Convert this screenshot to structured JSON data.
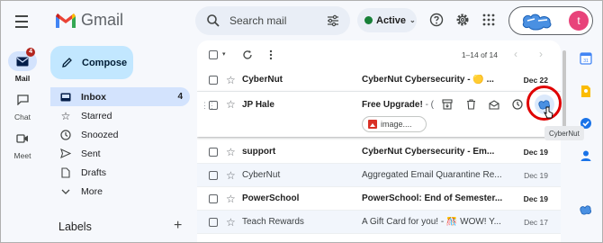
{
  "app": {
    "name": "Gmail"
  },
  "rail": {
    "mail": {
      "label": "Mail",
      "badge": "4"
    },
    "chat": {
      "label": "Chat"
    },
    "meet": {
      "label": "Meet"
    }
  },
  "search": {
    "placeholder": "Search mail"
  },
  "status": {
    "label": "Active",
    "color": "#188038"
  },
  "account": {
    "avatar_letter": "t",
    "avatar_color": "#e8437a"
  },
  "compose": {
    "label": "Compose"
  },
  "nav": [
    {
      "label": "Inbox",
      "count": "4",
      "icon": "inbox-icon",
      "active": true
    },
    {
      "label": "Starred",
      "icon": "star-icon"
    },
    {
      "label": "Snoozed",
      "icon": "clock-icon"
    },
    {
      "label": "Sent",
      "icon": "send-icon"
    },
    {
      "label": "Drafts",
      "icon": "draft-icon"
    },
    {
      "label": "More",
      "icon": "chevron-down-icon"
    }
  ],
  "labels": {
    "heading": "Labels",
    "add": "+"
  },
  "toolbar": {
    "pager": "1–14 of 14"
  },
  "emails": [
    {
      "sender": "CyberNut",
      "subject": "CyberNut Cybersecurity - 🟡 ...",
      "date": "Dec 22",
      "unread": true
    },
    {
      "sender": "JP Hale",
      "subject": "Free Upgrade!",
      "subject_cut": " - (",
      "attachment": "image....",
      "date": "",
      "unread": true,
      "hovered": true
    },
    {
      "sender": "support",
      "subject": "CyberNut Cybersecurity - Em...",
      "date": "Dec 19",
      "unread": true
    },
    {
      "sender": "CyberNut",
      "subject": "Aggregated Email Quarantine Re...",
      "date": "Dec 19",
      "unread": false
    },
    {
      "sender": "PowerSchool",
      "subject": "PowerSchool: End of Semester...",
      "date": "Dec 19",
      "unread": true
    },
    {
      "sender": "Teach Rewards",
      "subject": "A Gift Card for you! - 🎊 WOW! Y...",
      "date": "Dec 17",
      "unread": false
    }
  ],
  "tooltip": {
    "text": "CyberNut"
  },
  "colors": {
    "highlight_ring": "#e00000",
    "compose_bg": "#c2e7ff",
    "active_nav": "#d3e3fd"
  }
}
